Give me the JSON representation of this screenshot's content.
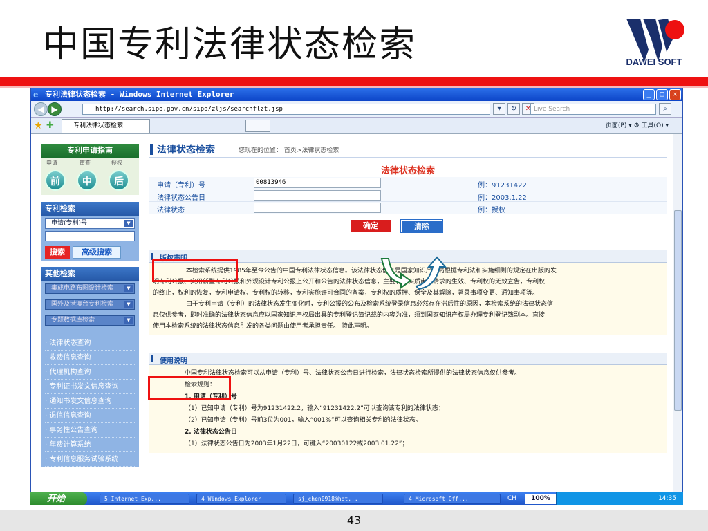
{
  "slide": {
    "title": "中国专利法律状态检索",
    "logo_text": "DAWEI SOFT",
    "page_number": "43"
  },
  "browser": {
    "window_title": "专利法律状态检索 - Windows Internet Explorer",
    "address": "http://search.sipo.gov.cn/sipo/zljs/searchflzt.jsp",
    "search_placeholder": "Live Search",
    "tab_label": "专利法律状态检索",
    "tools": "页面(P) ▾ ⚙ 工具(O) ▾"
  },
  "sidebar": {
    "guide_title": "专利申请指南",
    "guide_steps_labels": [
      "申请",
      "审查",
      "授权"
    ],
    "guide_circles": [
      "前",
      "中",
      "后"
    ],
    "patent_search_title": "专利检索",
    "search_select": "申请(专利)号",
    "search_button": "搜索",
    "advanced_button": "高级搜索",
    "other_title": "其他检索",
    "other_selects": [
      "集成电路布图设计检索",
      "国外及港澳台专利检索",
      "专题数据库检索"
    ],
    "links": [
      "法律状态查询",
      "收费信息查询",
      "代理机构查询",
      "专利证书发文信息查询",
      "通知书发文信息查询",
      "退信信息查询",
      "事务性公告查询",
      "年费计算系统",
      "专利信息服务试验系统"
    ]
  },
  "main": {
    "header_title": "法律状态检索",
    "breadcrumb": "您现在的位置： 首页>法律状态检索",
    "form_title": "法律状态检索",
    "fields": [
      {
        "label": "申请（专利）号",
        "value": "00813946",
        "example": "例：91231422"
      },
      {
        "label": "法律状态公告日",
        "value": "",
        "example": "例：2003.1.22"
      },
      {
        "label": "法律状态",
        "value": "",
        "example": "例：授权"
      }
    ],
    "ok_button": "确定",
    "clear_button": "清除",
    "copyright_title": "版权声明",
    "copyright_text": [
      "本检索系统提供1985年至今公告的中国专利法律状态信息。该法律状态信息是国家知识产权局根据专利法和实施细则的规定在出版的发",
      "明专利公报、实用新型专利公报和外观设计专利公报上公开和公告的法律状态信息，主要有：实质审查请求的生效、专利权的无效宣告，专利权",
      "的终止，权利的恢复，专利申请权、专利权的转移，专利实施许可合同的备案，专利权的质押、保全及其解除，著录事项变更、通知事项等。",
      "由于专利申请（专利）的法律状态发生变化时，专利公报的公布及检索系统登录信息必然存在滞后性的原因，本检索系统的法律状态信",
      "息仅供参考，即时准确的法律状态信息应以国家知识产权局出具的专利登记簿记载的内容为准，须到国家知识产权局办理专利登记簿副本。直接",
      "使用本检索系统的法律状态信息引发的各类问题由使用者承担责任。 特此声明。"
    ],
    "usage_title": "使用说明",
    "usage_text": [
      "中国专利法律状态检索可以从申请（专利）号、法律状态公告日进行检索，法律状态检索所提供的法律状态信息仅供参考。",
      "检索规则：",
      "1. 申请（专利）号",
      "（1）已知申请（专利）号为91231422.2，输入“91231422.2”可以查询该专利的法律状态；",
      "（2）已知申请（专利）号前3位为001，输入“001%”可以查询相关专利的法律状态。",
      "2. 法律状态公告日",
      "（1）法律状态公告日为2003年1月22日，可键入“20030122或2003.01.22”；"
    ]
  },
  "taskbar": {
    "start": "开始",
    "tasks": [
      "5 Internet Exp...",
      "4 Windows Explorer",
      "sj_chen0918@hot...",
      "4 Microsoft Off..."
    ],
    "lang": "CH",
    "zoom": "100%",
    "time": "14:35"
  },
  "colors": {
    "accent_red": "#e11111",
    "brand_blue": "#1a4f9e",
    "sidebar_green": "#2f8b3f"
  }
}
